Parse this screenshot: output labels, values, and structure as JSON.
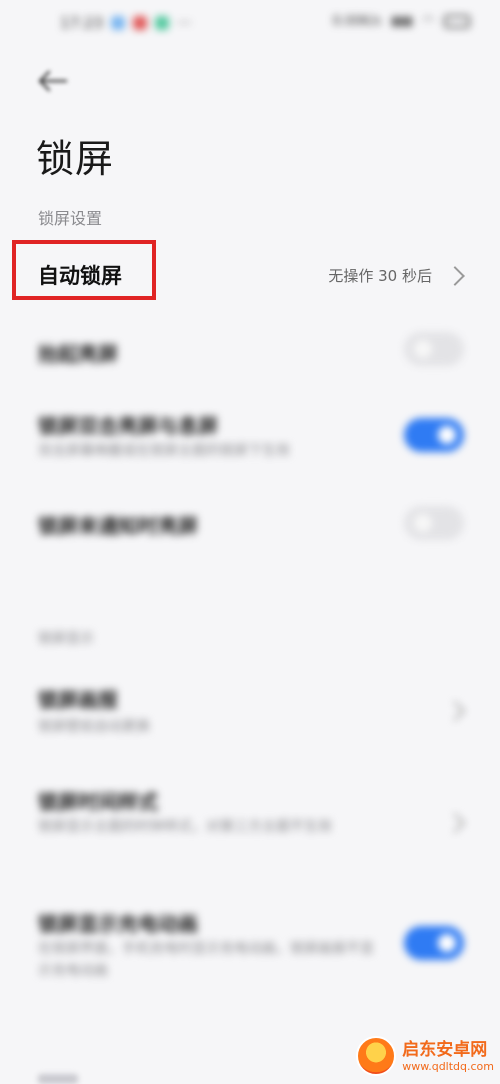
{
  "status_bar": {
    "time": "17:23",
    "right_text": "0.00K/s"
  },
  "title": "锁屏",
  "section_label": "锁屏设置",
  "auto_lock": {
    "label": "自动锁屏",
    "value": "无操作 30 秒后"
  },
  "rows": [
    {
      "title": "抬起亮屏",
      "toggle": false
    },
    {
      "title": "锁屏双击亮屏与息屏",
      "subtitle": "双击屏幕唤醒或在锁屏主题的锁屏下生效",
      "toggle": true
    },
    {
      "title": "锁屏来通知时亮屏",
      "toggle": false
    }
  ],
  "section2_label": "锁屏显示",
  "rows2": [
    {
      "title": "锁屏画报",
      "subtitle": "锁屏壁纸自动更换"
    },
    {
      "title": "锁屏时间样式",
      "subtitle": "锁屏显示主题的时钟样式，对第三方主题不生效"
    },
    {
      "title": "锁屏显示充电动画",
      "subtitle": "在锁屏界面，手机充电时显示充电动画，锁屏画报不显示充电动画",
      "toggle": true
    }
  ],
  "watermark": {
    "name_cn": "启东安卓网",
    "domain": "www.qdltdq.com"
  },
  "colors": {
    "accent": "#2f7bf3",
    "highlight": "#e02424",
    "background": "#f6f6f8"
  }
}
